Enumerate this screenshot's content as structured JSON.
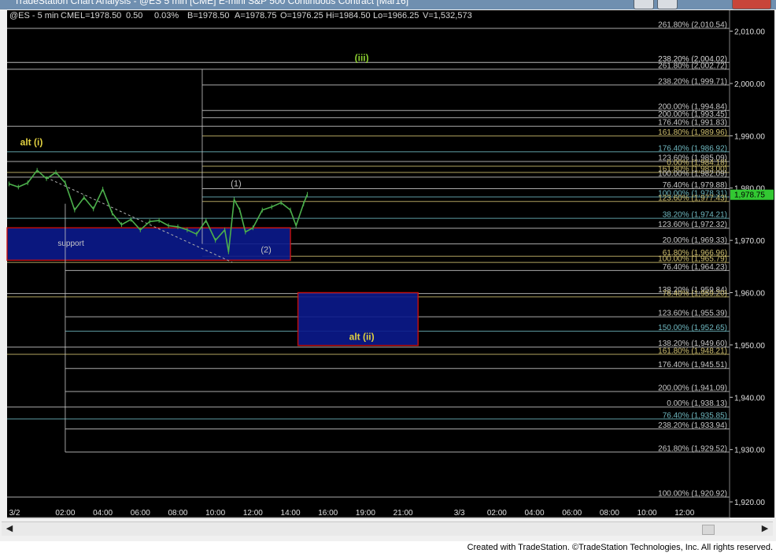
{
  "window": {
    "title": "TradeStation Chart Analysis - @ES 5 min [CME] E-mini S&P 500 Continuous Contract [Mar16]",
    "footer": "Created with TradeStation. ©TradeStation Technologies, Inc. All rights reserved."
  },
  "header": {
    "symbol": "@ES - 5 min",
    "exchange": "CME",
    "last": "L=1978.50",
    "change": "0.50",
    "pct": "0.03%",
    "bid": "B=1978.50",
    "ask": "A=1978.75",
    "open": "O=1976.25",
    "high": "Hi=1984.50",
    "low": "Lo=1966.25",
    "volume": "V=1,532,573"
  },
  "colors": {
    "background": "#000000",
    "price": "#4cb04c",
    "fib_line": "#c8c8c8",
    "fib_text": "#d8d8d8",
    "fib_gold": "#d0c070",
    "fib_teal": "#6fb8c0",
    "label_yellow": "#e0d040",
    "label_green": "#8ccf30",
    "box_fill": "#0c1a8c",
    "box_border": "#d01010",
    "last_price_bg": "#32c832"
  },
  "chart_data": {
    "type": "line",
    "title": "",
    "xlabel": "",
    "ylabel": "",
    "ylim": [
      1917,
      2014
    ],
    "yticks": [
      1920,
      1930,
      1940,
      1950,
      1960,
      1970,
      1980,
      1990,
      2000,
      2010
    ],
    "ytick_labels": [
      "1,920.00",
      "1,930.00",
      "1,940.00",
      "1,950.00",
      "1,960.00",
      "1,970.00",
      "1,980.00",
      "1,990.00",
      "2,000.00",
      "2,010.00"
    ],
    "x_range_hours": [
      -1.1,
      37.4
    ],
    "x_ticks": [
      {
        "label": "3/2",
        "h": -0.7
      },
      {
        "label": "02:00",
        "h": 2
      },
      {
        "label": "04:00",
        "h": 4
      },
      {
        "label": "06:00",
        "h": 6
      },
      {
        "label": "08:00",
        "h": 8
      },
      {
        "label": "10:00",
        "h": 10
      },
      {
        "label": "12:00",
        "h": 12
      },
      {
        "label": "14:00",
        "h": 14
      },
      {
        "label": "16:00",
        "h": 16
      },
      {
        "label": "19:00",
        "h": 18
      },
      {
        "label": "21:00",
        "h": 20
      },
      {
        "label": "3/3",
        "h": 23
      },
      {
        "label": "02:00",
        "h": 25
      },
      {
        "label": "04:00",
        "h": 27
      },
      {
        "label": "06:00",
        "h": 29
      },
      {
        "label": "08:00",
        "h": 31
      },
      {
        "label": "10:00",
        "h": 33
      },
      {
        "label": "12:00",
        "h": 35
      }
    ],
    "price_series": {
      "name": "@ES",
      "x": [
        -1.0,
        -0.5,
        0.0,
        0.5,
        1.0,
        1.5,
        2.0,
        2.5,
        3.0,
        3.5,
        4.0,
        4.5,
        5.0,
        5.5,
        6.0,
        6.5,
        7.0,
        7.5,
        8.0,
        8.5,
        9.0,
        9.5,
        10.0,
        10.5,
        10.7,
        11.0,
        11.3,
        11.6,
        12.0,
        12.5,
        13.0,
        13.5,
        14.0,
        14.3,
        14.7,
        14.9
      ],
      "y": [
        1980.8,
        1980.2,
        1981.0,
        1983.4,
        1981.8,
        1983.0,
        1981.0,
        1975.8,
        1978.2,
        1976.0,
        1979.8,
        1975.2,
        1973.0,
        1974.0,
        1972.0,
        1973.6,
        1973.8,
        1972.8,
        1972.6,
        1972.0,
        1971.2,
        1973.8,
        1970.0,
        1972.0,
        1967.8,
        1977.8,
        1975.8,
        1971.6,
        1972.4,
        1975.8,
        1976.4,
        1977.2,
        1975.8,
        1972.8,
        1977.0,
        1978.8
      ]
    },
    "last_price": "1,978.75",
    "fib_levels": [
      {
        "label": "261.80% (2,010.54)",
        "y": 2010.54,
        "x0": -1.1,
        "color": "#c8c8c8"
      },
      {
        "label": "238.20% (2,004.02)",
        "y": 2004.02,
        "x0": -1.1,
        "color": "#d8d8d8"
      },
      {
        "label": "261.80% (2,002.72)",
        "y": 2002.72,
        "x0": -1.1,
        "color": "#c8c8c8"
      },
      {
        "label": "238.20% (1,999.71)",
        "y": 1999.71,
        "x0": 9.3,
        "color": "#c8c8c8"
      },
      {
        "label": "200.00% (1,994.84)",
        "y": 1994.84,
        "x0": 9.3,
        "color": "#c8c8c8"
      },
      {
        "label": "200.00% (1,993.45)",
        "y": 1993.45,
        "x0": 9.3,
        "color": "#c8c8c8"
      },
      {
        "label": "176.40% (1,991.83)",
        "y": 1991.83,
        "x0": -1.1,
        "color": "#c8c8c8"
      },
      {
        "label": "161.80% (1,989.96)",
        "y": 1989.96,
        "x0": 9.3,
        "color": "#d0c070"
      },
      {
        "label": "176.40% (1,986.92)",
        "y": 1986.92,
        "x0": -1.1,
        "color": "#6fb8c0"
      },
      {
        "label": "123.60% (1,985.09)",
        "y": 1985.09,
        "x0": -1.1,
        "color": "#c8c8c8"
      },
      {
        "label": "0.00% (1,984.18)",
        "y": 1984.18,
        "x0": 9.3,
        "color": "#d0c070"
      },
      {
        "label": "161.80% (1,983.00)",
        "y": 1983.0,
        "x0": -1.1,
        "color": "#d0c070"
      },
      {
        "label": "100.00% (1,982.09)",
        "y": 1982.09,
        "x0": -1.1,
        "color": "#c8c8c8"
      },
      {
        "label": "76.40% (1,979.88)",
        "y": 1979.88,
        "x0": 9.3,
        "color": "#c8c8c8"
      },
      {
        "label": "100.00% (1,978.31)",
        "y": 1978.31,
        "x0": 9.3,
        "color": "#6fb8c0"
      },
      {
        "label": "123.60% (1,977.43)",
        "y": 1977.43,
        "x0": 9.3,
        "color": "#d0c070"
      },
      {
        "label": "38.20% (1,974.21)",
        "y": 1974.21,
        "x0": -1.1,
        "color": "#6fb8c0"
      },
      {
        "label": "123.60% (1,972.32)",
        "y": 1972.32,
        "x0": 9.3,
        "color": "#c8c8c8"
      },
      {
        "label": "20.00% (1,969.33)",
        "y": 1969.33,
        "x0": 9.3,
        "color": "#c8c8c8"
      },
      {
        "label": "61.80% (1,966.96)",
        "y": 1966.96,
        "x0": 9.3,
        "color": "#d0c070"
      },
      {
        "label": "100.00% (1,965.79)",
        "y": 1965.79,
        "x0": -1.1,
        "color": "#d0c070"
      },
      {
        "label": "76.40% (1,964.23)",
        "y": 1964.23,
        "x0": 2.0,
        "color": "#c8c8c8"
      },
      {
        "label": "138.20% (1,959.84)",
        "y": 1959.84,
        "x0": -1.1,
        "color": "#c8c8c8"
      },
      {
        "label": "76.40% (1,959.20)",
        "y": 1959.2,
        "x0": -1.1,
        "color": "#d0c070"
      },
      {
        "label": "123.60% (1,955.39)",
        "y": 1955.39,
        "x0": 2.0,
        "color": "#c8c8c8"
      },
      {
        "label": "150.00% (1,952.65)",
        "y": 1952.65,
        "x0": 2.0,
        "color": "#6fb8c0"
      },
      {
        "label": "138.20% (1,949.60)",
        "y": 1949.6,
        "x0": -1.1,
        "color": "#c8c8c8"
      },
      {
        "label": "161.80% (1,948.21)",
        "y": 1948.21,
        "x0": -1.1,
        "color": "#d0c070"
      },
      {
        "label": "176.40% (1,945.51)",
        "y": 1945.51,
        "x0": 2.0,
        "color": "#c8c8c8"
      },
      {
        "label": "200.00% (1,941.09)",
        "y": 1941.09,
        "x0": 2.0,
        "color": "#c8c8c8"
      },
      {
        "label": "0.00% (1,938.13)",
        "y": 1938.13,
        "x0": -1.1,
        "color": "#c8c8c8"
      },
      {
        "label": "76.40% (1,935.85)",
        "y": 1935.85,
        "x0": -1.1,
        "color": "#6fb8c0"
      },
      {
        "label": "238.20% (1,933.94)",
        "y": 1933.94,
        "x0": 2.0,
        "color": "#c8c8c8"
      },
      {
        "label": "261.80% (1,929.52)",
        "y": 1929.52,
        "x0": 2.0,
        "color": "#c8c8c8"
      },
      {
        "label": "100.00% (1,920.92)",
        "y": 1920.92,
        "x0": -1.1,
        "color": "#c8c8c8"
      }
    ],
    "verticals": [
      {
        "x": 2.0,
        "y0": 1929.52,
        "y1": 1977.0
      },
      {
        "x": 9.3,
        "y0": 1969.33,
        "y1": 2002.72
      }
    ],
    "boxes": [
      {
        "name": "support-box",
        "x0": -1.1,
        "x1": 14.0,
        "y0": 1966.2,
        "y1": 1972.4
      },
      {
        "name": "alt-ii-box",
        "x0": 14.4,
        "x1": 20.8,
        "y0": 1949.9,
        "y1": 1960.0
      }
    ],
    "trendline": {
      "x0": 1.0,
      "y0": 1982.0,
      "x1": 10.9,
      "y1": 1965.8
    },
    "annotations": [
      {
        "text": "alt (i)",
        "x": 0.2,
        "y": 1988.2,
        "color": "#e0d040",
        "size": 12
      },
      {
        "text": "(iii)",
        "x": 17.8,
        "y": 2004.3,
        "color": "#8ccf30",
        "size": 12
      },
      {
        "text": "(1)",
        "x": 11.1,
        "y": 1980.3,
        "color": "#c0c0c0",
        "size": 11
      },
      {
        "text": "(2)",
        "x": 12.7,
        "y": 1967.7,
        "color": "#c0c0c0",
        "size": 11
      },
      {
        "text": "support",
        "x": 2.3,
        "y": 1969.0,
        "color": "#c8c8c8",
        "size": 10
      },
      {
        "text": "alt (ii)",
        "x": 17.8,
        "y": 1951.0,
        "color": "#e0d040",
        "size": 12
      }
    ]
  }
}
